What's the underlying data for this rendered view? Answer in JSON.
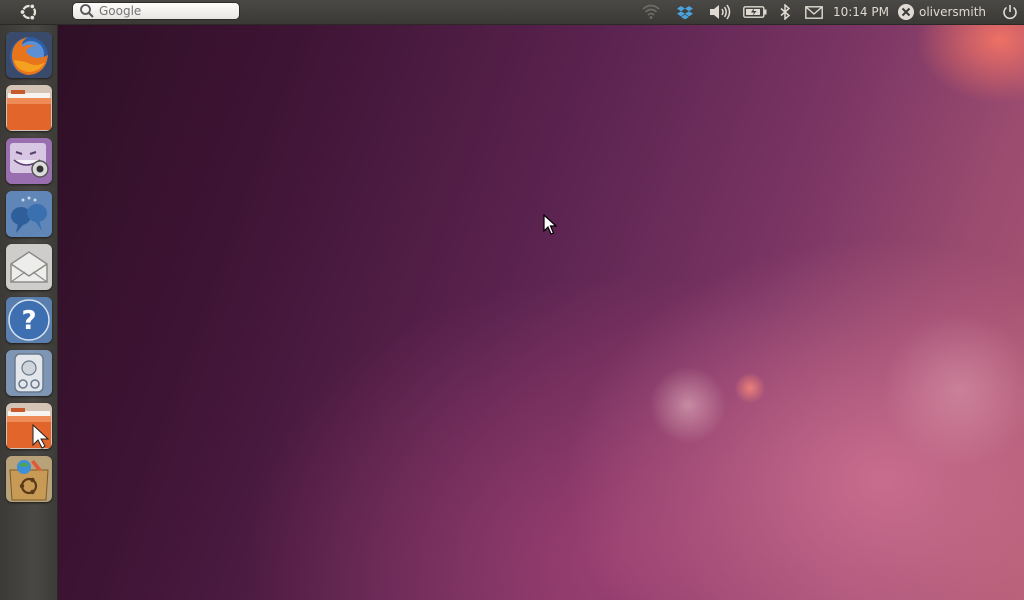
{
  "top_panel": {
    "search": {
      "placeholder": "Google",
      "value": ""
    },
    "indicators": {
      "network_icon": "wifi-icon",
      "dropbox_icon": "dropbox-icon",
      "sound_icon": "volume-icon",
      "battery_icon": "battery-icon",
      "bluetooth_icon": "bluetooth-icon",
      "messages_icon": "envelope-icon",
      "clock": "10:14 PM",
      "user_name": "oliversmith",
      "session_icon": "power-icon"
    }
  },
  "launcher": {
    "items": [
      {
        "name": "Firefox Web Browser",
        "icon": "firefox-icon"
      },
      {
        "name": "Home Folder",
        "icon": "folder-icon"
      },
      {
        "name": "Cheese Webcam Booth",
        "icon": "webcam-icon"
      },
      {
        "name": "Empathy",
        "icon": "chat-icon"
      },
      {
        "name": "Evolution Mail",
        "icon": "mail-icon"
      },
      {
        "name": "Help",
        "icon": "help-icon"
      },
      {
        "name": "Disk Utility",
        "icon": "harddisk-icon"
      },
      {
        "name": "File Browser",
        "icon": "folder-pointer-icon"
      },
      {
        "name": "Ubuntu Software Center",
        "icon": "software-center-icon"
      }
    ]
  },
  "colors": {
    "panel_bg": "#3c3b37",
    "panel_text": "#dfdbd2",
    "wallpaper_dark": "#2a0e22",
    "wallpaper_light": "#b05a72"
  }
}
